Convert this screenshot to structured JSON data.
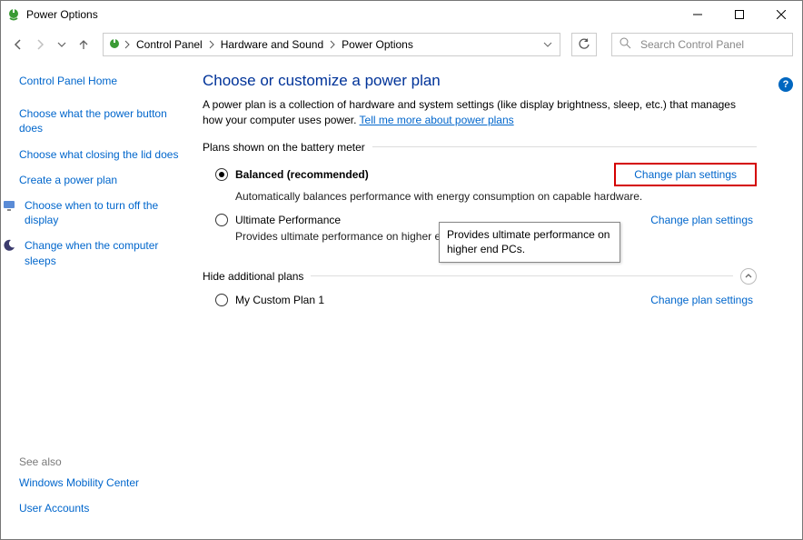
{
  "window": {
    "title": "Power Options"
  },
  "breadcrumb": {
    "root": "Control Panel",
    "category": "Hardware and Sound",
    "page": "Power Options"
  },
  "search": {
    "placeholder": "Search Control Panel"
  },
  "sidebar": {
    "home": "Control Panel Home",
    "links": {
      "power_button": "Choose what the power button does",
      "close_lid": "Choose what closing the lid does",
      "create_plan": "Create a power plan",
      "display_off": "Choose when to turn off the display",
      "sleep": "Change when the computer sleeps"
    }
  },
  "see_also": {
    "header": "See also",
    "mobility": "Windows Mobility Center",
    "accounts": "User Accounts"
  },
  "main": {
    "title": "Choose or customize a power plan",
    "desc_pre": "A power plan is a collection of hardware and system settings (like display brightness, sleep, etc.) that manages how your computer uses power. ",
    "desc_link": "Tell me more about power plans",
    "section_battery": "Plans shown on the battery meter",
    "section_hide": "Hide additional plans",
    "change_link": "Change plan settings",
    "plans": {
      "balanced": {
        "name": "Balanced (recommended)",
        "desc": "Automatically balances performance with energy consumption on capable hardware."
      },
      "ultimate": {
        "name": "Ultimate Performance",
        "desc_visible": "Provides ultimate performance on higher en"
      },
      "custom": {
        "name": "My Custom Plan 1"
      }
    },
    "tooltip": "Provides ultimate performance on higher end PCs."
  }
}
